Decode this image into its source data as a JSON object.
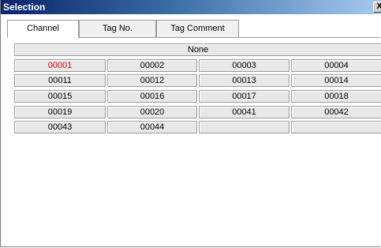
{
  "window": {
    "title": "Selection",
    "close_label": "X"
  },
  "tabs": [
    {
      "label": "Channel",
      "active": true
    },
    {
      "label": "Tag No.",
      "active": false
    },
    {
      "label": "Tag Comment",
      "active": false
    }
  ],
  "none_label": "None",
  "grid": [
    [
      "00001",
      "00002",
      "00003",
      "00004"
    ],
    [
      "00011",
      "00012",
      "00013",
      "00014"
    ],
    [
      "00015",
      "00016",
      "00017",
      "00018"
    ],
    [
      "00019",
      "00020",
      "00041",
      "00042"
    ],
    [
      "00043",
      "00044",
      "",
      ""
    ]
  ],
  "colors": {
    "selected_text": "#e00000",
    "titlebar": "#0a246a"
  }
}
